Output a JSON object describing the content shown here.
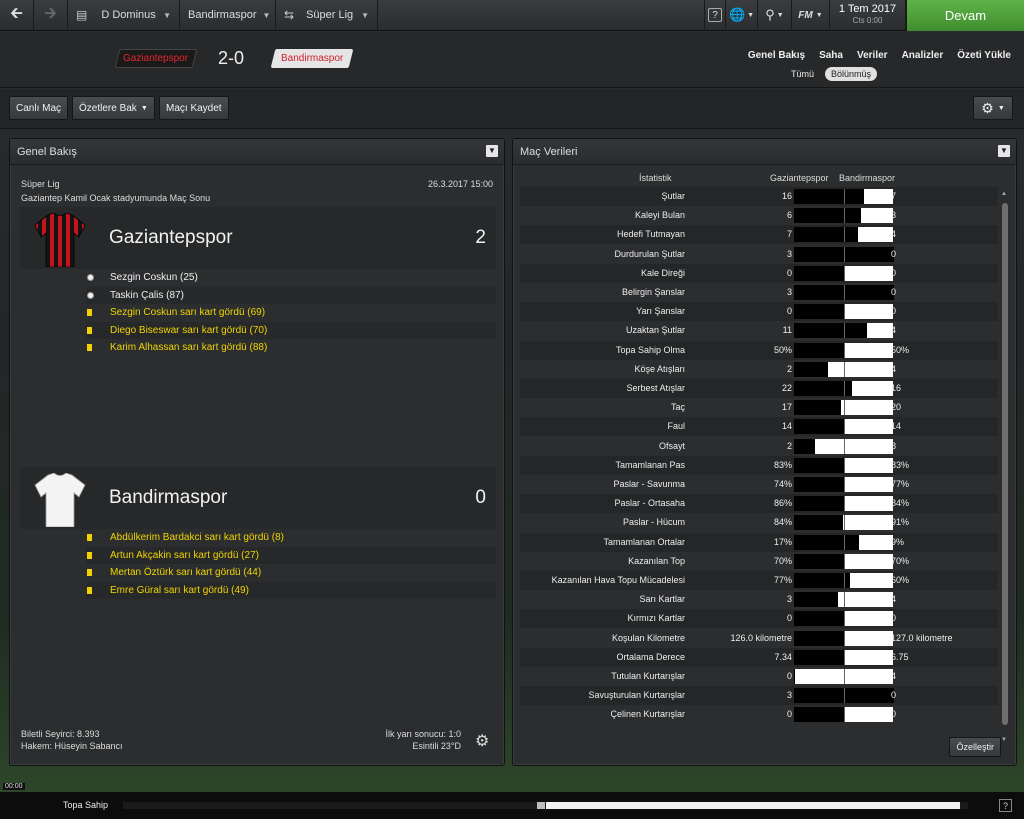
{
  "topbar": {
    "manager": "D Dominus",
    "club": "Bandirmaspor",
    "league": "Süper Lig",
    "date": "1 Tem 2017",
    "day": "Cts 0:00",
    "continue_label": "Devam",
    "fm_label": "FM",
    "help": "?"
  },
  "header": {
    "home_tag": "Gaziantepspor",
    "away_tag": "Bandirmaspor",
    "score": "2-0",
    "nav": [
      "Genel Bakış",
      "Saha",
      "Veriler",
      "Analizler",
      "Özeti Yükle"
    ],
    "sub": [
      "Tümü",
      "Bölünmüş"
    ]
  },
  "toolbar": {
    "live": "Canlı Maç",
    "highlights": "Özetlere Bak",
    "save": "Maçı Kaydet"
  },
  "left_panel": {
    "title": "Genel Bakış",
    "competition": "Süper Lig",
    "venue": "Gaziantep Kamil Ocak stadyumunda Maç Sonu",
    "date": "26.3.2017 15:00",
    "home": {
      "name": "Gaziantepspor",
      "score": "2",
      "events": [
        {
          "type": "goal",
          "text": "Sezgin Coskun (25)"
        },
        {
          "type": "goal",
          "text": "Taskin Çalis (87)"
        },
        {
          "type": "yellow",
          "text": "Sezgin Coskun sarı kart gördü (69)"
        },
        {
          "type": "yellow",
          "text": "Diego Biseswar sarı kart gördü (70)"
        },
        {
          "type": "yellow",
          "text": "Karim Alhassan sarı kart gördü (88)"
        }
      ]
    },
    "away": {
      "name": "Bandirmaspor",
      "score": "0",
      "events": [
        {
          "type": "yellow",
          "text": "Abdülkerim Bardakci sarı kart gördü (8)"
        },
        {
          "type": "yellow",
          "text": "Artun Akçakin sarı kart gördü (27)"
        },
        {
          "type": "yellow",
          "text": "Mertan Öztürk sarı kart gördü (44)"
        },
        {
          "type": "yellow",
          "text": "Emre Güral sarı kart gördü (49)"
        }
      ]
    },
    "attendance": "Biletli Seyirci: 8.393",
    "referee": "Hakem: Hüseyin Sabancı",
    "halftime": "İlk yarı sonucu: 1:0",
    "weather": "Esintili 23°D"
  },
  "right_panel": {
    "title": "Maç Verileri",
    "col_stat": "İstatistik",
    "col_home": "Gaziantepspor",
    "col_away": "Bandirmaspor",
    "customize": "Özelleştir",
    "stats": [
      {
        "label": "Şutlar",
        "home": "16",
        "away": "7",
        "home_share": 0.7
      },
      {
        "label": "Kaleyi Bulan",
        "home": "6",
        "away": "3",
        "home_share": 0.67
      },
      {
        "label": "Hedefi Tutmayan",
        "home": "7",
        "away": "4",
        "home_share": 0.64
      },
      {
        "label": "Durdurulan Şutlar",
        "home": "3",
        "away": "0",
        "home_share": 1.0
      },
      {
        "label": "Kale Direği",
        "home": "0",
        "away": "0",
        "home_share": 0.5
      },
      {
        "label": "Belirgin Şanslar",
        "home": "3",
        "away": "0",
        "home_share": 1.0
      },
      {
        "label": "Yarı Şanslar",
        "home": "0",
        "away": "0",
        "home_share": 0.5
      },
      {
        "label": "Uzaktan Şutlar",
        "home": "11",
        "away": "4",
        "home_share": 0.73
      },
      {
        "label": "Topa Sahip Olma",
        "home": "50%",
        "away": "50%",
        "home_share": 0.5
      },
      {
        "label": "Köşe Atışları",
        "home": "2",
        "away": "4",
        "home_share": 0.33
      },
      {
        "label": "Serbest Atışlar",
        "home": "22",
        "away": "16",
        "home_share": 0.58
      },
      {
        "label": "Taç",
        "home": "17",
        "away": "20",
        "home_share": 0.46
      },
      {
        "label": "Faul",
        "home": "14",
        "away": "14",
        "home_share": 0.5
      },
      {
        "label": "Ofsayt",
        "home": "2",
        "away": "8",
        "home_share": 0.2
      },
      {
        "label": "Tamamlanan Pas",
        "home": "83%",
        "away": "83%",
        "home_share": 0.5
      },
      {
        "label": "Paslar - Savunma",
        "home": "74%",
        "away": "77%",
        "home_share": 0.49
      },
      {
        "label": "Paslar - Ortasaha",
        "home": "86%",
        "away": "84%",
        "home_share": 0.51
      },
      {
        "label": "Paslar - Hücum",
        "home": "84%",
        "away": "91%",
        "home_share": 0.48
      },
      {
        "label": "Tamamlanan Ortalar",
        "home": "17%",
        "away": "9%",
        "home_share": 0.65
      },
      {
        "label": "Kazanılan Top",
        "home": "70%",
        "away": "70%",
        "home_share": 0.5
      },
      {
        "label": "Kazanılan Hava Topu Mücadelesi",
        "home": "77%",
        "away": "60%",
        "home_share": 0.56
      },
      {
        "label": "Sarı Kartlar",
        "home": "3",
        "away": "4",
        "home_share": 0.43
      },
      {
        "label": "Kırmızı Kartlar",
        "home": "0",
        "away": "0",
        "home_share": 0.5
      },
      {
        "label": "Koşulan Kilometre",
        "home": "126.0 kilometre",
        "away": "127.0 kilometre",
        "home_share": 0.5
      },
      {
        "label": "Ortalama Derece",
        "home": "7.34",
        "away": "6.75",
        "home_share": 0.5
      },
      {
        "label": "Tutulan Kurtarışlar",
        "home": "0",
        "away": "4",
        "home_share": 0.0
      },
      {
        "label": "Savuşturulan Kurtarışlar",
        "home": "3",
        "away": "0",
        "home_share": 1.0
      },
      {
        "label": "Çelinen Kurtarışlar",
        "home": "0",
        "away": "0",
        "home_share": 0.5
      }
    ]
  },
  "bottombar": {
    "time": "00:00",
    "label": "Topa Sahip",
    "help": "?",
    "possession": [
      {
        "start": 0.49,
        "end": 0.5
      },
      {
        "start": 0.5,
        "end": 0.99
      }
    ]
  },
  "colors": {
    "home_red": "#e3262f",
    "continue_green": "#4fa03a",
    "card_yellow": "#f2d200"
  }
}
